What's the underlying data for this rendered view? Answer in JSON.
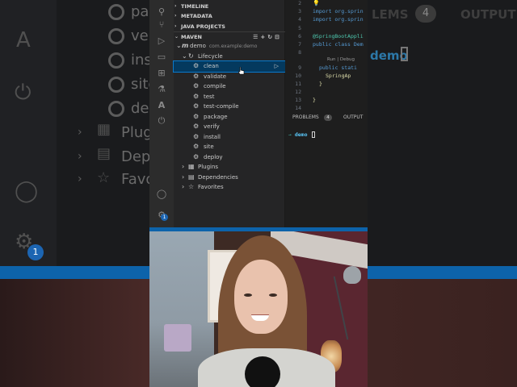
{
  "background": {
    "left_texts": [
      "pac",
      "ver",
      "inst",
      "site",
      "dep"
    ],
    "plugins": "Plugi",
    "dependencies": "Depe",
    "favorites": "Favo",
    "right_problems": "LEMS",
    "right_badge": "4",
    "right_output": "OUTPUT",
    "right_demo": "demo",
    "notification_count": "1"
  },
  "sidebar": {
    "sections": {
      "timeline": "TIMELINE",
      "metadata": "METADATA",
      "java_projects": "JAVA PROJECTS",
      "maven": "MAVEN"
    },
    "project": {
      "name": "demo",
      "id": "com.example:demo"
    },
    "lifecycle_label": "Lifecycle",
    "lifecycle_items": [
      "clean",
      "validate",
      "compile",
      "test",
      "test-compile",
      "package",
      "verify",
      "install",
      "site",
      "deploy"
    ],
    "other_nodes": [
      "Plugins",
      "Dependencies",
      "Favorites"
    ],
    "selected_item": "clean"
  },
  "activity_bar": {
    "icons": [
      "files-icon",
      "source-control-icon",
      "run-debug-icon",
      "remote-explorer-icon",
      "extensions-icon",
      "testing-icon",
      "azure-icon",
      "spring-boot-icon",
      "account-icon",
      "settings-icon"
    ],
    "notification_badge": "1"
  },
  "editor": {
    "lines": [
      {
        "n": "2",
        "t": ""
      },
      {
        "n": "3",
        "t": "import org.sprin"
      },
      {
        "n": "4",
        "t": "import org.sprin"
      },
      {
        "n": "5",
        "t": ""
      },
      {
        "n": "6",
        "t": "@SpringBootAppli"
      },
      {
        "n": "7",
        "t": "public class Dem"
      },
      {
        "n": "8",
        "t": ""
      },
      {
        "n": "9",
        "t": "public stati"
      },
      {
        "n": "10",
        "t": "SpringAp"
      },
      {
        "n": "11",
        "t": "}"
      },
      {
        "n": "12",
        "t": ""
      },
      {
        "n": "13",
        "t": "}"
      },
      {
        "n": "14",
        "t": ""
      }
    ],
    "codelens": "Run | Debug"
  },
  "panel": {
    "problems": "PROBLEMS",
    "problems_count": "4",
    "output": "OUTPUT",
    "prompt_arrow": "→",
    "prompt_dir": "demo"
  },
  "colors": {
    "accent_blue": "#0d63aa",
    "selection": "#04395e",
    "sidebar_bg": "#252526",
    "editor_bg": "#1e1e1e"
  }
}
